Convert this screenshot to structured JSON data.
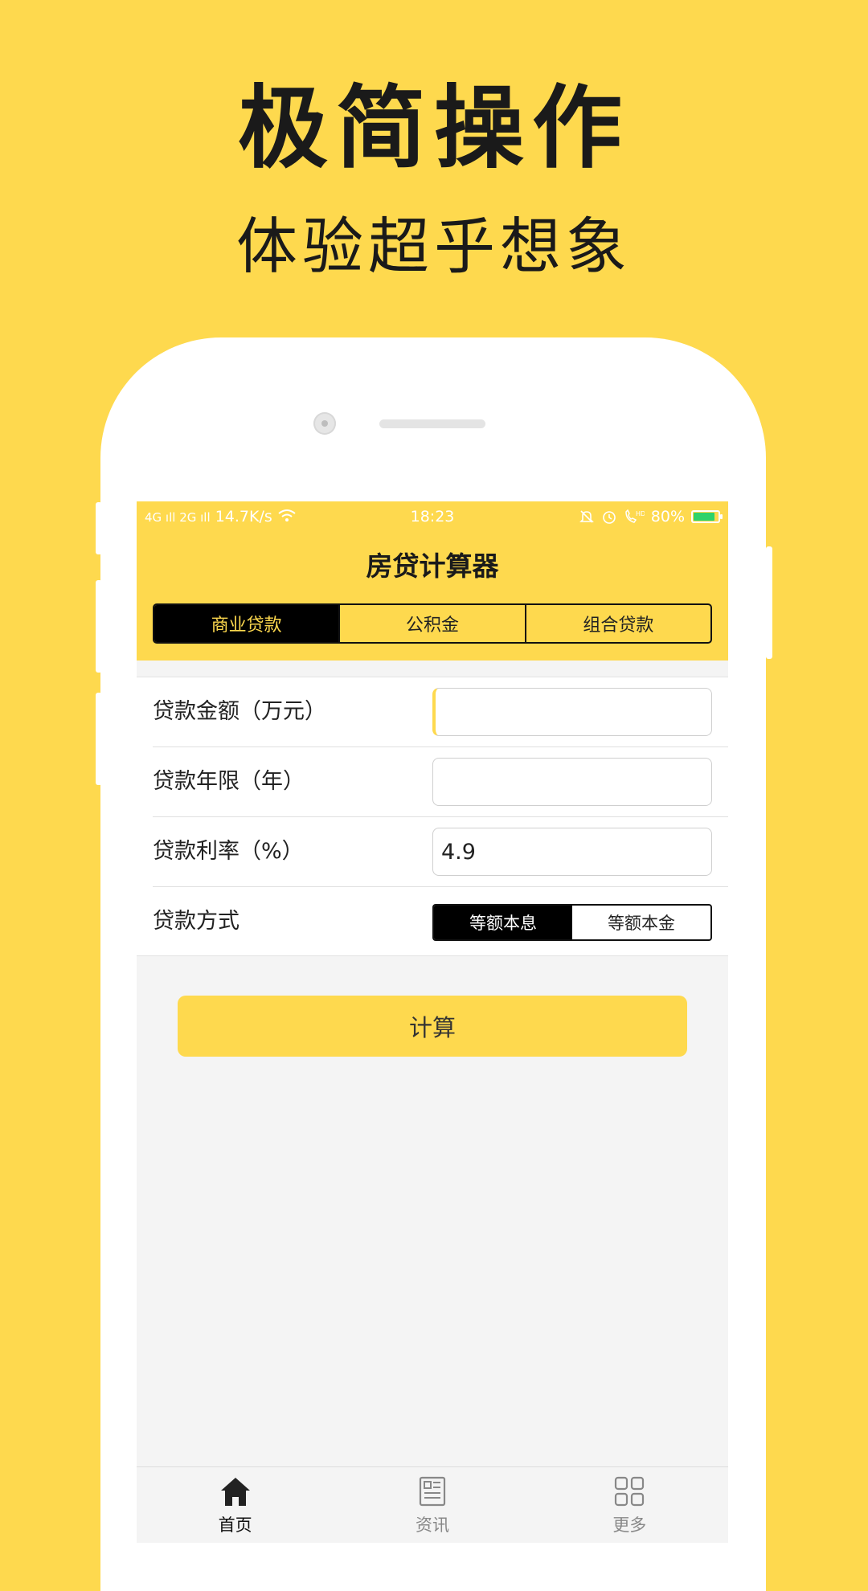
{
  "promo": {
    "title": "极简操作",
    "subtitle": "体验超乎想象"
  },
  "status_bar": {
    "network": "4G ıll 2G ıll",
    "speed": "14.7K/s",
    "time": "18:23",
    "battery": "80%"
  },
  "header": {
    "title": "房贷计算器",
    "tabs": [
      {
        "label": "商业贷款",
        "active": true
      },
      {
        "label": "公积金",
        "active": false
      },
      {
        "label": "组合贷款",
        "active": false
      }
    ]
  },
  "form": {
    "amount": {
      "label": "贷款金额（万元）",
      "value": ""
    },
    "years": {
      "label": "贷款年限（年）",
      "value": ""
    },
    "rate": {
      "label": "贷款利率（%）",
      "value": "4.9"
    },
    "method": {
      "label": "贷款方式",
      "options": [
        {
          "label": "等额本息",
          "active": true
        },
        {
          "label": "等额本金",
          "active": false
        }
      ]
    }
  },
  "calculate_button": "计算",
  "tab_bar": {
    "items": [
      {
        "label": "首页",
        "icon": "home-icon",
        "active": true
      },
      {
        "label": "资讯",
        "icon": "news-icon",
        "active": false
      },
      {
        "label": "更多",
        "icon": "grid-icon",
        "active": false
      }
    ]
  },
  "colors": {
    "accent": "#FED94E",
    "dark": "#000000",
    "screen_bg": "#F4F4F4"
  }
}
